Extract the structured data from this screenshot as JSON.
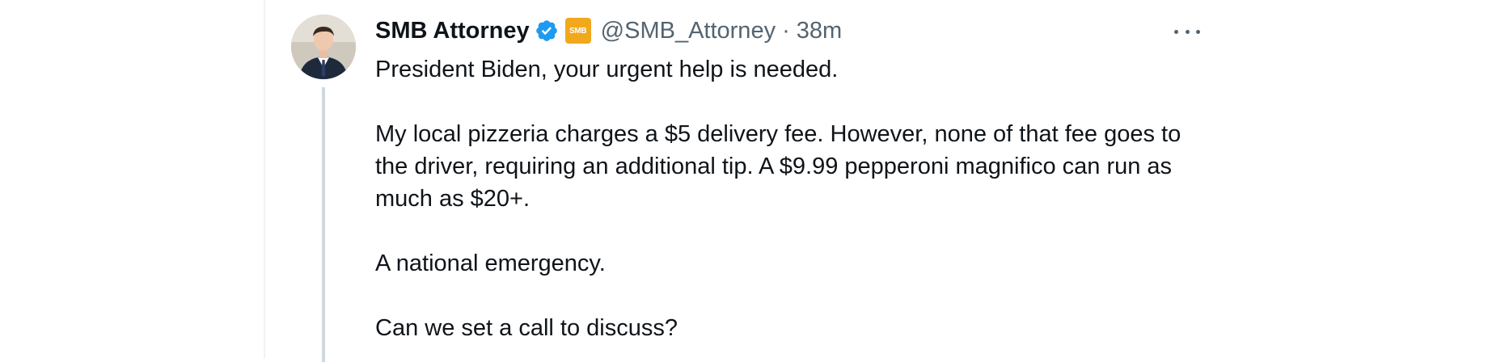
{
  "tweet": {
    "author_name": "SMB Attorney",
    "affiliate_badge": "SMB",
    "handle": "@SMB_Attorney",
    "separator": "·",
    "time": "38m",
    "paragraphs": [
      "President Biden, your urgent help is needed.",
      "My local pizzeria charges a $5 delivery fee. However, none of that fee goes to the driver, requiring an additional tip. A $9.99 pepperoni magnifico can run as much as $20+.",
      "A national emergency.",
      "Can we set a call to discuss?"
    ]
  },
  "icons": {
    "verified": "verified-badge-icon",
    "more": "more-options-icon"
  },
  "colors": {
    "verified_blue": "#1d9bf0",
    "affiliate_gold": "#f2a81d",
    "secondary_text": "#536471",
    "thread_line": "#cfd9de"
  }
}
